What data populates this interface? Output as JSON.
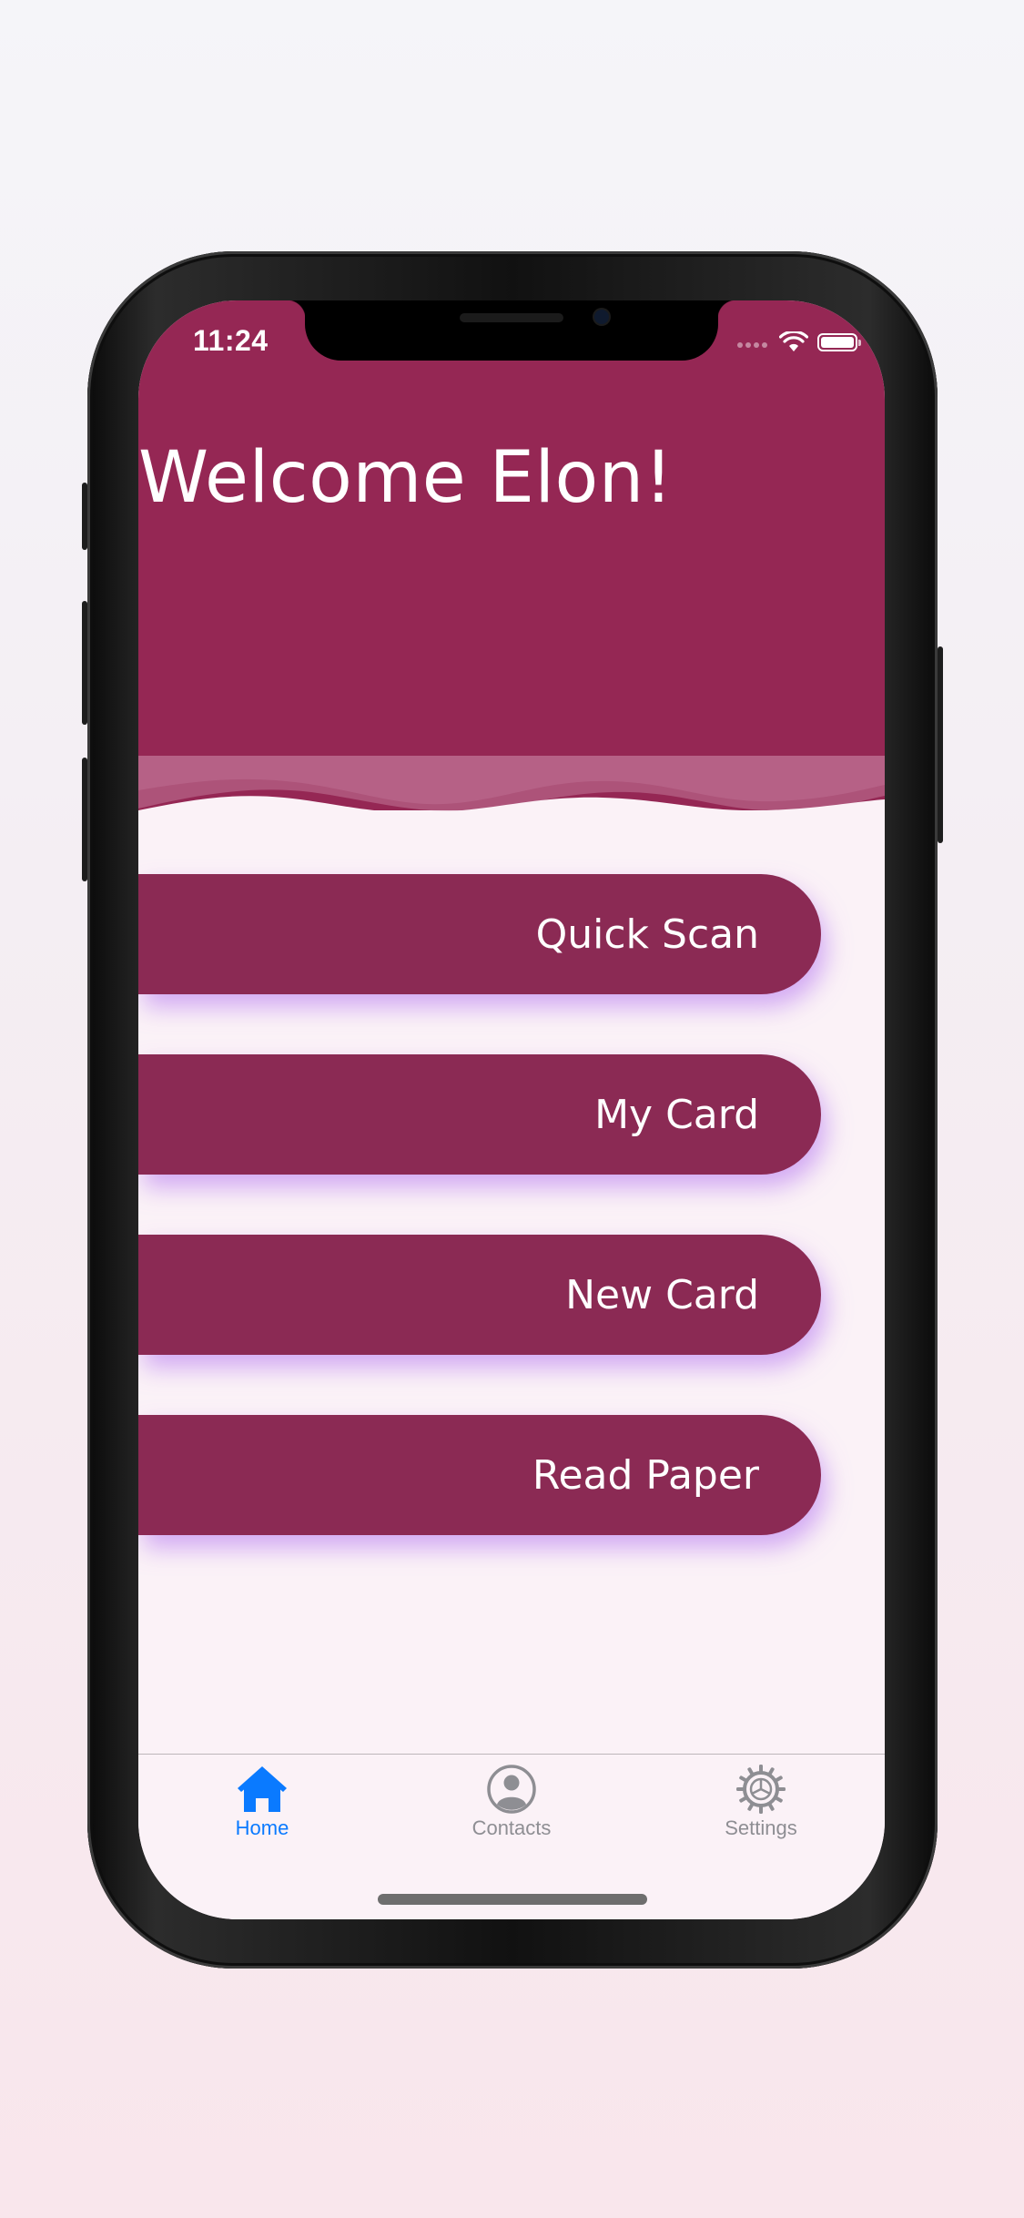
{
  "status_bar": {
    "time": "11:24"
  },
  "header": {
    "title": "Welcome Elon!",
    "background_color": "#952754"
  },
  "menu": {
    "items": [
      {
        "label": "Quick Scan"
      },
      {
        "label": "My Card"
      },
      {
        "label": "New Card"
      },
      {
        "label": "Read Paper"
      }
    ],
    "button_color": "#8b2a54",
    "glow_color": "#b06ef0"
  },
  "tab_bar": {
    "tabs": [
      {
        "label": "Home",
        "icon": "house-icon",
        "active": true
      },
      {
        "label": "Contacts",
        "icon": "person-circle-icon",
        "active": false
      },
      {
        "label": "Settings",
        "icon": "gear-icon",
        "active": false
      }
    ],
    "active_color": "#0a7aff",
    "inactive_color": "#8e8e93"
  }
}
